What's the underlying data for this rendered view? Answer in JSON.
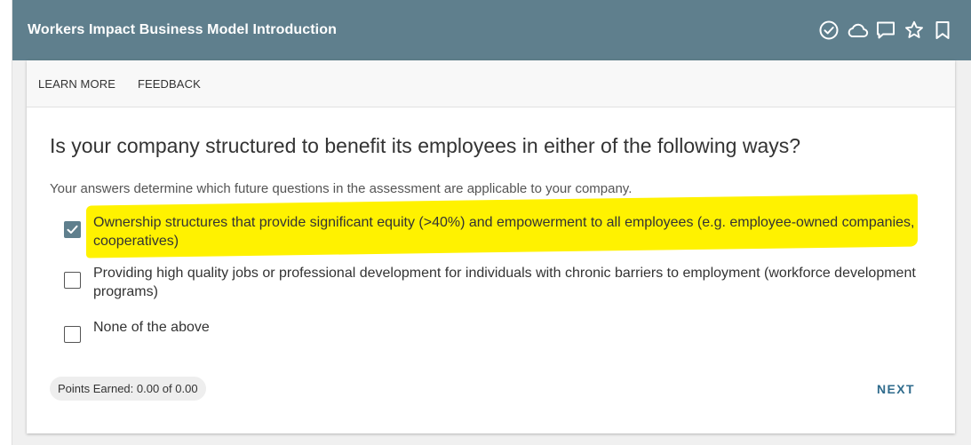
{
  "header": {
    "title": "Workers Impact Business Model Introduction",
    "icons": [
      "check-circle-icon",
      "cloud-icon",
      "comment-icon",
      "star-icon",
      "bookmark-icon"
    ]
  },
  "tabs": [
    {
      "label": "LEARN MORE"
    },
    {
      "label": "FEEDBACK"
    }
  ],
  "question": {
    "text": "Is your company structured to benefit its employees in either of the following ways?",
    "helper": "Your answers determine which future questions in the assessment are applicable to your company."
  },
  "options": [
    {
      "label": "Ownership structures that provide significant equity (>40%) and empowerment to all employees (e.g. employee-owned companies, cooperatives)",
      "checked": true
    },
    {
      "label": "Providing high quality jobs or professional development for individuals with chronic barriers to employment (workforce development programs)",
      "checked": false
    },
    {
      "label": "None of the above",
      "checked": false
    }
  ],
  "footer": {
    "points": "Points Earned: 0.00 of 0.00",
    "next_label": "NEXT"
  },
  "colors": {
    "header_bg": "#5f7f8d",
    "highlight": "#fff200",
    "next_link": "#2f6b8c"
  }
}
